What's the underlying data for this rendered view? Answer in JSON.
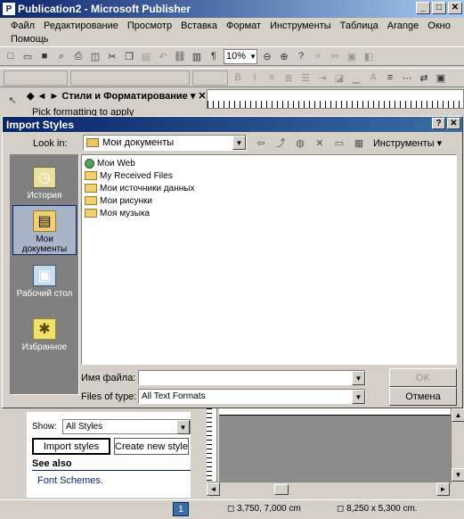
{
  "window": {
    "title": "Publication2 - Microsoft Publisher",
    "app_icon": "P",
    "minimize": "_",
    "maximize": "□",
    "close": "✕"
  },
  "menu": [
    "Файл",
    "Редактирование",
    "Просмотр",
    "Вставка",
    "Формат",
    "Инструменты",
    "Таблица",
    "Arange",
    "Окно",
    "Помощь"
  ],
  "toolbar": {
    "zoom": "10%"
  },
  "taskpane": {
    "header": "Стили и Форматирование",
    "subtext": "Pick formatting to apply",
    "show_label": "Show:",
    "show_value": "All Styles",
    "import_button": "Import styles",
    "create_button": "Create new style",
    "see_also": "See also",
    "font_schemes": "Font Schemes."
  },
  "dialog": {
    "title": "Import Styles",
    "help": "?",
    "close": "✕",
    "look_in_label": "Look in:",
    "look_in_value": "Мои документы",
    "tools_label": "Инструменты ▾",
    "places": [
      {
        "label": "История",
        "icon": "history-icon"
      },
      {
        "label": "Мои документы",
        "icon": "my-documents-icon"
      },
      {
        "label": "Рабочий стол",
        "icon": "desktop-icon"
      },
      {
        "label": "Избранное",
        "icon": "favorites-icon"
      }
    ],
    "files": [
      {
        "name": "Мои Web",
        "icon": "web-folder-icon"
      },
      {
        "name": "My Received Files",
        "icon": "folder-icon"
      },
      {
        "name": "Мои источники данных",
        "icon": "folder-icon"
      },
      {
        "name": "Мои рисунки",
        "icon": "folder-icon"
      },
      {
        "name": "Моя музыка",
        "icon": "folder-icon"
      }
    ],
    "file_name_label": "Имя файла:",
    "file_name_value": "",
    "files_of_type_label": "Files of type:",
    "files_of_type_value": "All Text Formats",
    "ok_button": "OK",
    "cancel_button": "Отмена"
  },
  "status": {
    "page": "1",
    "position": "3,750, 7,000 cm",
    "size": "8,250 x 5,300 cm."
  }
}
